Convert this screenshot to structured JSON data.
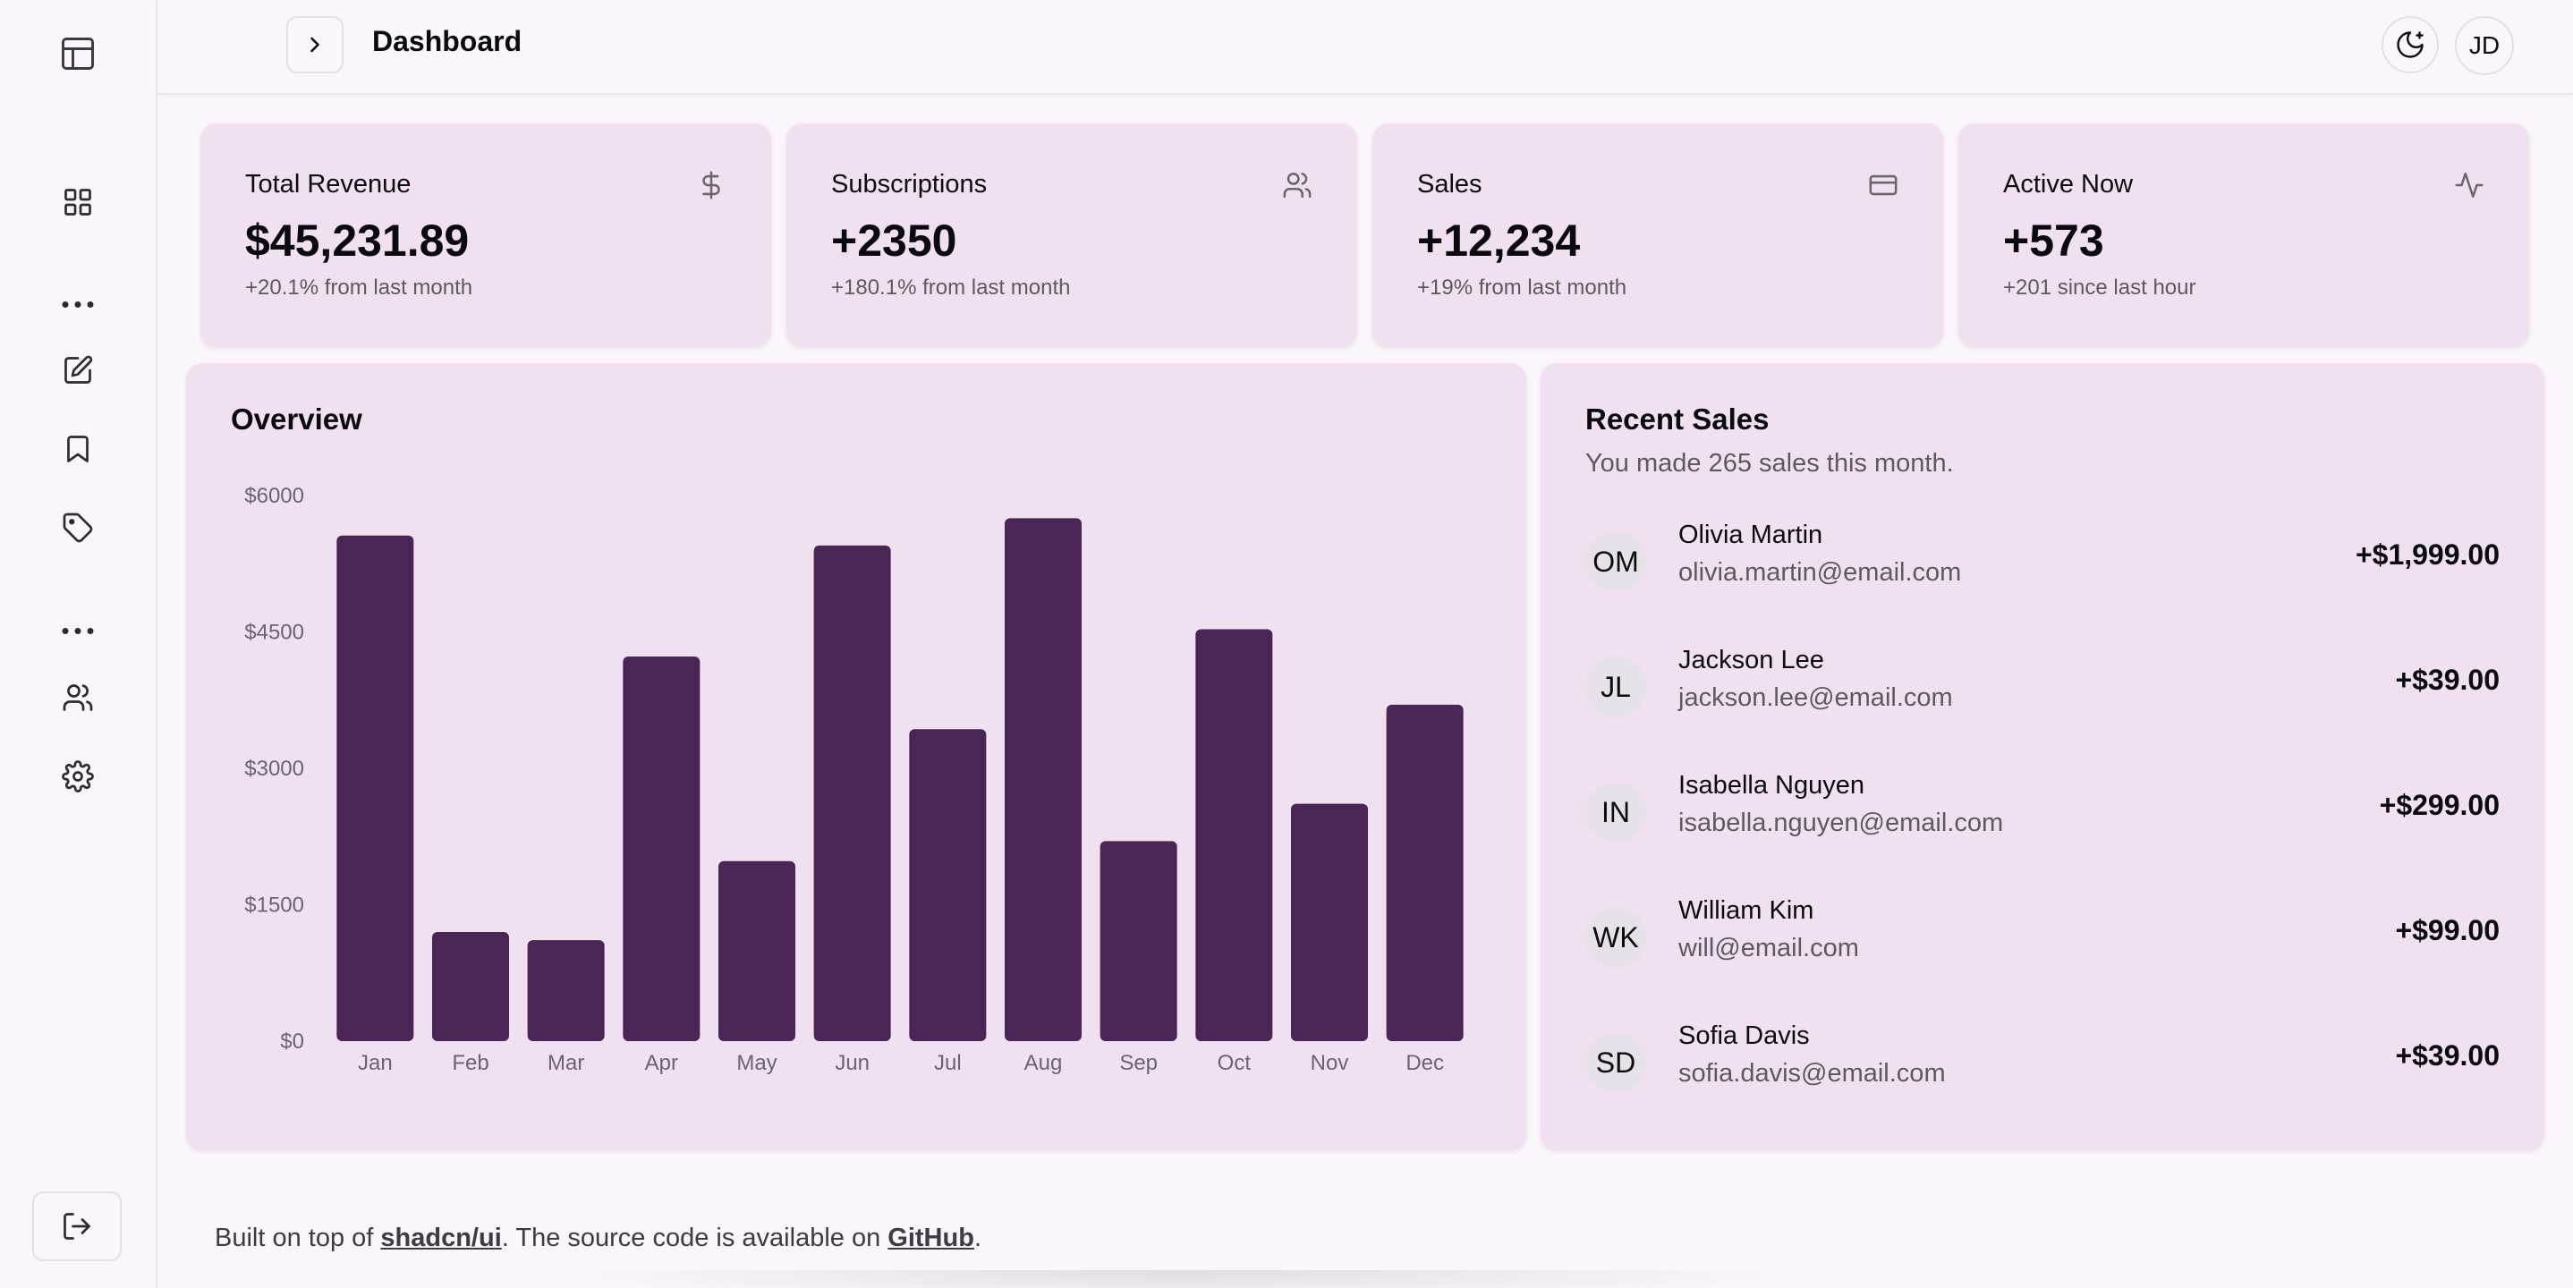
{
  "header": {
    "title": "Dashboard",
    "avatar_initials": "JD"
  },
  "sidebar": {
    "items": [
      {
        "icon": "dashboard-grid-icon"
      },
      {
        "icon": "edit-icon"
      },
      {
        "icon": "bookmark-icon"
      },
      {
        "icon": "tag-icon"
      },
      {
        "icon": "users-icon"
      },
      {
        "icon": "settings-gear-icon"
      }
    ],
    "logout_icon": "logout-icon"
  },
  "stats": [
    {
      "title": "Total Revenue",
      "value": "$45,231.89",
      "note": "+20.1% from last month",
      "icon": "dollar-icon"
    },
    {
      "title": "Subscriptions",
      "value": "+2350",
      "note": "+180.1% from last month",
      "icon": "users-icon"
    },
    {
      "title": "Sales",
      "value": "+12,234",
      "note": "+19% from last month",
      "icon": "credit-card-icon"
    },
    {
      "title": "Active Now",
      "value": "+573",
      "note": "+201 since last hour",
      "icon": "activity-icon"
    }
  ],
  "overview": {
    "title": "Overview"
  },
  "chart_data": {
    "type": "bar",
    "title": "Overview",
    "categories": [
      "Jan",
      "Feb",
      "Mar",
      "Apr",
      "May",
      "Jun",
      "Jul",
      "Aug",
      "Sep",
      "Oct",
      "Nov",
      "Dec"
    ],
    "values": [
      5560,
      1200,
      1110,
      4230,
      1980,
      5450,
      3430,
      5750,
      2200,
      4530,
      2610,
      3700
    ],
    "yticks": [
      "$0",
      "$1500",
      "$3000",
      "$4500",
      "$6000"
    ],
    "ylim": [
      0,
      6000
    ],
    "bar_color": "#4a2656",
    "grid": false
  },
  "recent_sales": {
    "title": "Recent Sales",
    "subtitle": "You made 265 sales this month.",
    "items": [
      {
        "initials": "OM",
        "name": "Olivia Martin",
        "email": "olivia.martin@email.com",
        "amount": "+$1,999.00"
      },
      {
        "initials": "JL",
        "name": "Jackson Lee",
        "email": "jackson.lee@email.com",
        "amount": "+$39.00"
      },
      {
        "initials": "IN",
        "name": "Isabella Nguyen",
        "email": "isabella.nguyen@email.com",
        "amount": "+$299.00"
      },
      {
        "initials": "WK",
        "name": "William Kim",
        "email": "will@email.com",
        "amount": "+$99.00"
      },
      {
        "initials": "SD",
        "name": "Sofia Davis",
        "email": "sofia.davis@email.com",
        "amount": "+$39.00"
      }
    ]
  },
  "footer": {
    "prefix": "Built on top of ",
    "link1": "shadcn/ui",
    "middle": ". The source code is available on ",
    "link2": "GitHub",
    "suffix": "."
  },
  "colors": {
    "accent": "#4a2656",
    "card_bg": "#f0e1f1",
    "page_bg": "#fbf6fb"
  }
}
